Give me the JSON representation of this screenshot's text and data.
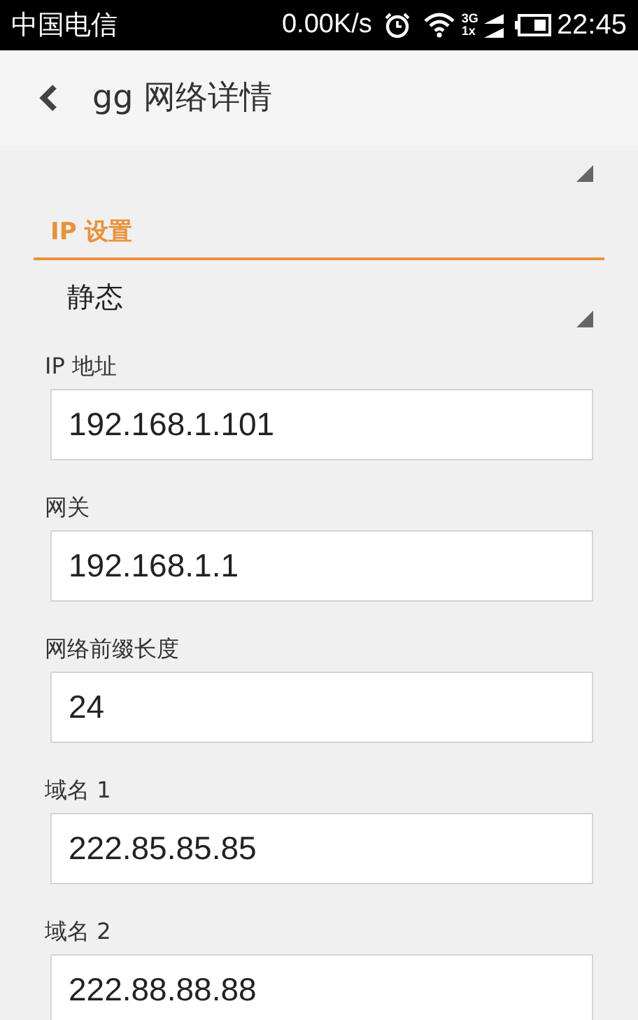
{
  "status_bar": {
    "carrier": "中国电信",
    "speed": "0.00K/s",
    "network": "3G",
    "network_alt": "1x",
    "time": "22:45"
  },
  "header": {
    "title": "gg 网络详情"
  },
  "section": {
    "title": "IP 设置",
    "dropdown_value": "静态"
  },
  "fields": [
    {
      "label": "IP 地址",
      "value": "192.168.1.101"
    },
    {
      "label": "网关",
      "value": "192.168.1.1"
    },
    {
      "label": "网络前缀长度",
      "value": "24"
    },
    {
      "label": "域名 1",
      "value": "222.85.85.85"
    },
    {
      "label": "域名 2",
      "value": "222.88.88.88"
    }
  ]
}
